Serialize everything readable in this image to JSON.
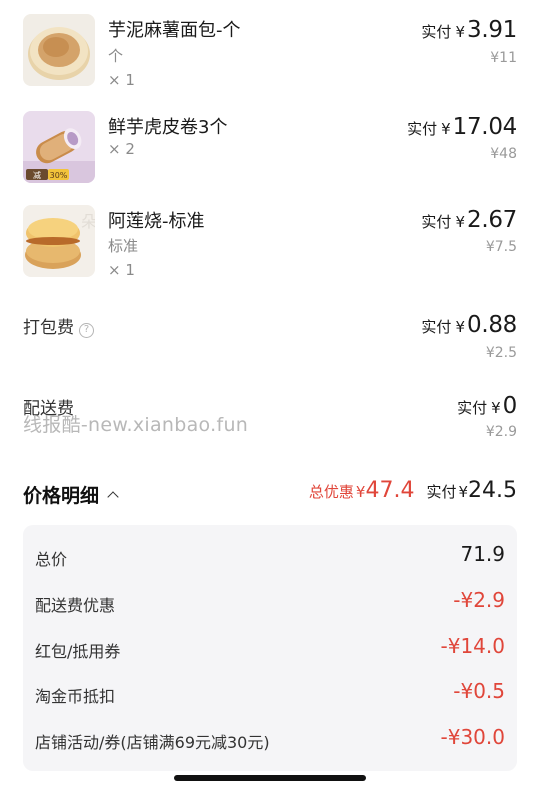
{
  "items": [
    {
      "name": "芋泥麻薯面包-个",
      "spec": "个",
      "qty": "× 1",
      "paid_label": "实付",
      "currency": "¥",
      "paid": "3.91",
      "original": "¥11",
      "image": "round-bread-image"
    },
    {
      "name": "鲜芋虎皮卷3个",
      "spec": "",
      "qty": "× 2",
      "paid_label": "实付",
      "currency": "¥",
      "paid": "17.04",
      "original": "¥48",
      "image": "taro-roll-image",
      "badge_a": "减",
      "badge_b": "30%"
    },
    {
      "name": "阿莲烧-标准",
      "spec": "标准",
      "qty": "× 1",
      "paid_label": "实付",
      "currency": "¥",
      "paid": "2.67",
      "original": "¥7.5",
      "image": "pastry-image"
    }
  ],
  "packing_fee": {
    "label": "打包费",
    "help_icon": "question-circle-icon",
    "paid_label": "实付",
    "currency": "¥",
    "paid": "0.88",
    "original": "¥2.5"
  },
  "delivery_fee": {
    "label": "配送费",
    "paid_label": "实付",
    "currency": "¥",
    "paid": "0",
    "original": "¥2.9"
  },
  "watermark": "线报酷-new.xianbao.fun",
  "price_detail": {
    "title": "价格明细",
    "toggle_icon": "chevron-up-icon",
    "discount_label": "总优惠",
    "discount_currency": "¥",
    "discount_amount": "47.4",
    "pay_label": "实付",
    "pay_currency": "¥",
    "pay_amount": "24.5",
    "rows": [
      {
        "label": "总价",
        "value": "71.9"
      },
      {
        "label": "配送费优惠",
        "value": "-¥2.9"
      },
      {
        "label": "红包/抵用券",
        "value": "-¥14.0"
      },
      {
        "label": "淘金币抵扣",
        "value": "-¥0.5"
      },
      {
        "label": "店铺活动/券(店铺满69元减30元)",
        "value": "-¥30.0"
      }
    ]
  },
  "colors": {
    "accent_red": "#e0463a",
    "text_primary": "#1a1a1a",
    "text_secondary": "#8a8a8a",
    "detail_bg": "#f5f5f7"
  }
}
